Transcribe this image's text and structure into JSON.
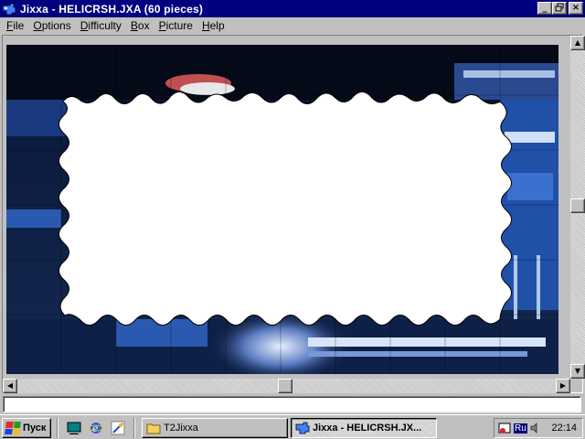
{
  "window": {
    "title": "Jixxa - HELICRSH.JXA (60 pieces)",
    "app_icon": "jixxa-app-icon",
    "controls": {
      "minimize": "_",
      "maximize": "□",
      "close": "×"
    }
  },
  "menu": {
    "items": [
      {
        "label_first": "F",
        "label_rest": "ile"
      },
      {
        "label_first": "O",
        "label_rest": "ptions"
      },
      {
        "label_first": "D",
        "label_rest": "ifficulty"
      },
      {
        "label_first": "B",
        "label_rest": "ox"
      },
      {
        "label_first": "P",
        "label_rest": "icture"
      },
      {
        "label_first": "H",
        "label_rest": "elp"
      }
    ]
  },
  "puzzle": {
    "description_icon": "jigsaw-board",
    "colors": {
      "dark": "#0a1a3a",
      "blue": "#3a6ac8",
      "light_blue": "#7aa8e8",
      "white": "#ffffff"
    }
  },
  "status": {
    "text": ""
  },
  "taskbar": {
    "start_label": "Пуск",
    "quick_launch": [
      "desktop-icon",
      "browser-icon",
      "channels-icon"
    ],
    "tasks": [
      {
        "label": "T2Jixxa",
        "icon": "folder-icon",
        "active": false
      },
      {
        "label": "Jixxa - HELICRSH.JX...",
        "icon": "jixxa-app-icon",
        "active": true
      }
    ],
    "tray": {
      "lang": "Ru",
      "clock": "22:14"
    }
  },
  "colors": {
    "titlebar": "#000080",
    "face": "#c0c0c0"
  }
}
